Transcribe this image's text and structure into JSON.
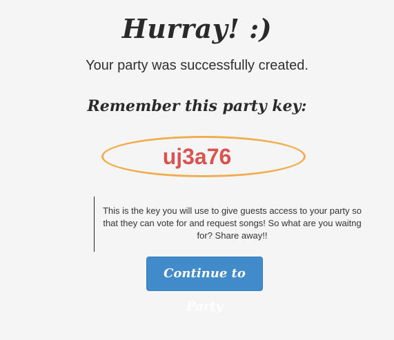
{
  "header": {
    "title": "Hurray!  :)",
    "subtitle": "Your party was successfully created."
  },
  "key_section": {
    "label": "Remember this party key:",
    "party_key": "uj3a76"
  },
  "info": {
    "text": "This is the key you will use to give guests access to your party so that they can vote for and request songs! So what are you waitng for? Share away!!"
  },
  "actions": {
    "continue_label": "Continue to Party"
  },
  "colors": {
    "background": "#f5f5f5",
    "key_text": "#d9534f",
    "key_oval": "#f0ad4e",
    "button_bg": "#428bca",
    "button_text": "#ffffff"
  }
}
